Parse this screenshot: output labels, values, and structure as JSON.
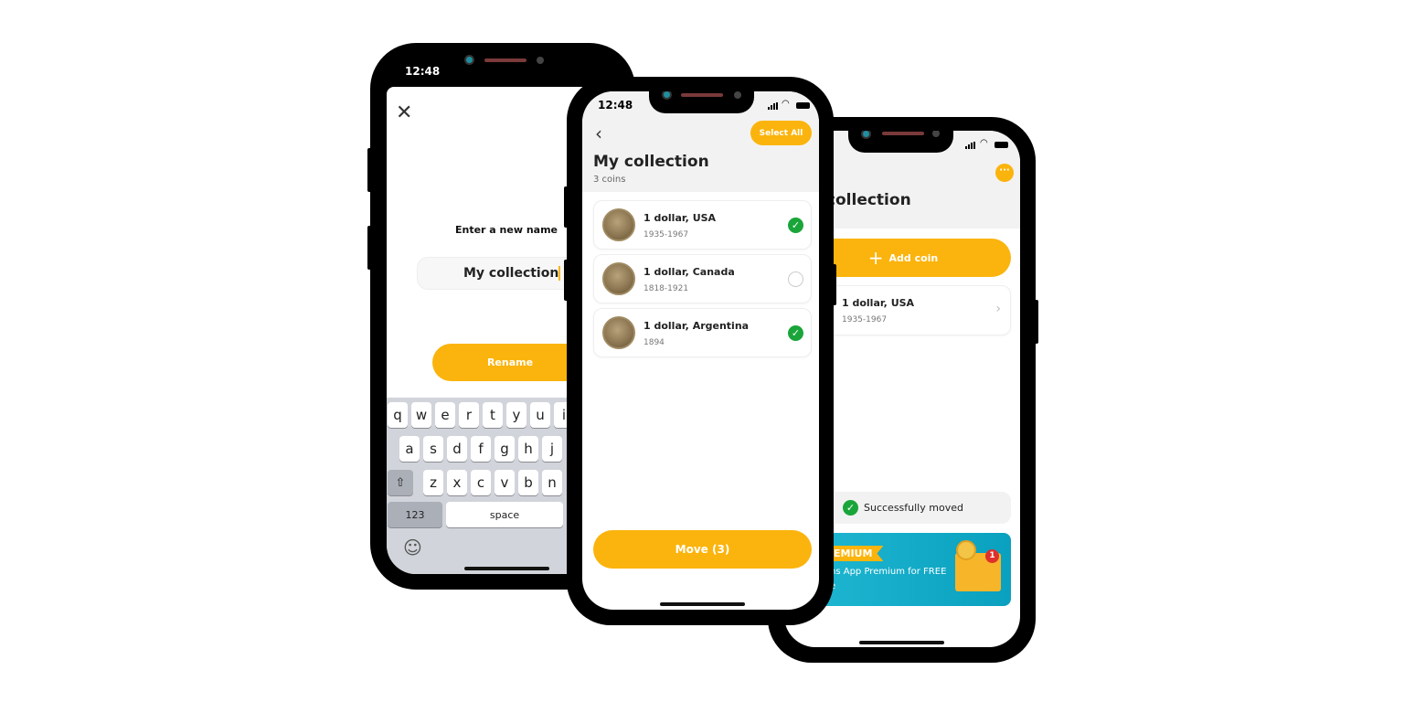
{
  "rename_screen": {
    "time": "12:48",
    "close_icon": "close-x-icon",
    "prompt": "Enter a new name",
    "input_value": "My collection",
    "rename_label": "Rename",
    "keyboard": {
      "row1": [
        "q",
        "w",
        "e",
        "r",
        "t",
        "y",
        "u",
        "i"
      ],
      "row2": [
        "a",
        "s",
        "d",
        "f",
        "g",
        "h",
        "j"
      ],
      "row3": [
        "z",
        "x",
        "c",
        "v",
        "b",
        "n"
      ],
      "shift_icon": "shift-arrow-icon",
      "numbers_label": "123",
      "space_label": "space",
      "emoji_icon": "smiley-icon"
    }
  },
  "select_screen": {
    "time": "12:48",
    "select_all_label": "Select All",
    "title": "My collection",
    "subtitle": "3 coins",
    "coins": [
      {
        "name": "1 dollar, USA",
        "years": "1935-1967",
        "selected": true
      },
      {
        "name": "1 dollar, Canada",
        "years": "1818-1921",
        "selected": false
      },
      {
        "name": "1 dollar, Argentina",
        "years": "1894",
        "selected": true
      }
    ],
    "move_label": "Move (3)"
  },
  "collection_screen": {
    "menu_icon": "ellipsis-icon",
    "title": "My collection",
    "add_coin_label": "Add coin",
    "coins": [
      {
        "name": "1 dollar, USA",
        "years": "1935-1967"
      }
    ],
    "toast": "Successfully moved",
    "banner": {
      "badge": "EMIUM",
      "line1": "ns App Premium for FREE",
      "line2": "e",
      "notification_count": "1"
    }
  },
  "colors": {
    "accent": "#fbb40d",
    "success": "#1aa53a",
    "banner": "#12aac6"
  }
}
